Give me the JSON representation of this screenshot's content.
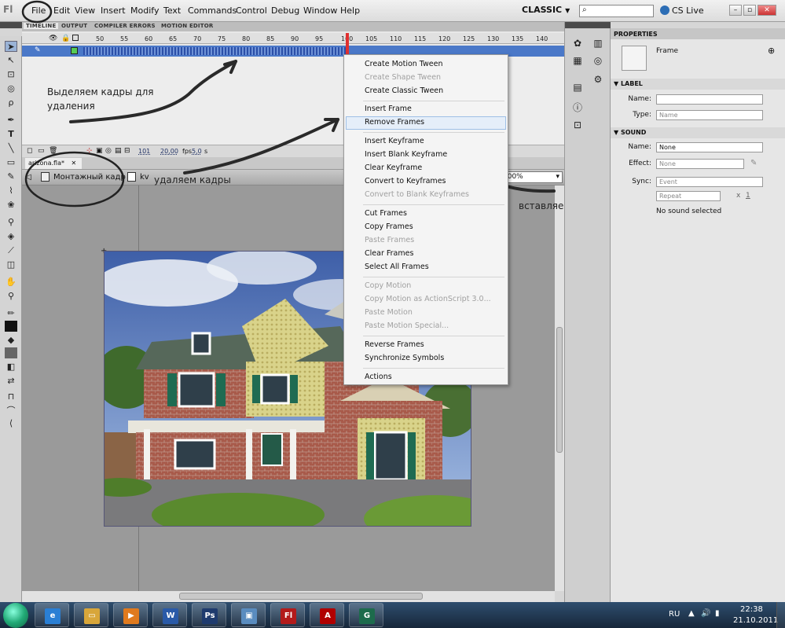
{
  "menubar": {
    "items": [
      "File",
      "Edit",
      "View",
      "Insert",
      "Modify",
      "Text",
      "Commands",
      "Control",
      "Debug",
      "Window",
      "Help"
    ],
    "workspace": "CLASSIC",
    "search_placeholder": "",
    "cslive": "CS Live"
  },
  "timeline": {
    "tabs": [
      "TIMELINE",
      "OUTPUT",
      "COMPILER ERRORS",
      "MOTION EDITOR"
    ],
    "ruler": [
      "50",
      "55",
      "60",
      "65",
      "70",
      "75",
      "80",
      "85",
      "90",
      "95",
      "100",
      "105",
      "110",
      "115",
      "120",
      "125",
      "130",
      "135",
      "140"
    ],
    "status": {
      "frame": "101",
      "fps": "20,00",
      "fps_unit": "fps",
      "time": "5,0",
      "time_unit": "s"
    }
  },
  "document": {
    "tab": "arizona.fla*",
    "scene": "Монтажный кадр 1",
    "symbol": "kv",
    "zoom": "100%"
  },
  "context_menu": {
    "groups": [
      [
        {
          "label": "Create Motion Tween",
          "enabled": true
        },
        {
          "label": "Create Shape Tween",
          "enabled": false
        },
        {
          "label": "Create Classic Tween",
          "enabled": true
        }
      ],
      [
        {
          "label": "Insert Frame",
          "enabled": true
        },
        {
          "label": "Remove Frames",
          "enabled": true
        }
      ],
      [
        {
          "label": "Insert Keyframe",
          "enabled": true
        },
        {
          "label": "Insert Blank Keyframe",
          "enabled": true
        },
        {
          "label": "Clear Keyframe",
          "enabled": true
        },
        {
          "label": "Convert to Keyframes",
          "enabled": true
        },
        {
          "label": "Convert to Blank Keyframes",
          "enabled": false
        }
      ],
      [
        {
          "label": "Cut Frames",
          "enabled": true
        },
        {
          "label": "Copy Frames",
          "enabled": true
        },
        {
          "label": "Paste Frames",
          "enabled": false
        },
        {
          "label": "Clear Frames",
          "enabled": true
        },
        {
          "label": "Select All Frames",
          "enabled": true
        }
      ],
      [
        {
          "label": "Copy Motion",
          "enabled": false
        },
        {
          "label": "Copy Motion as ActionScript 3.0...",
          "enabled": false
        },
        {
          "label": "Paste Motion",
          "enabled": false
        },
        {
          "label": "Paste Motion Special...",
          "enabled": false
        }
      ],
      [
        {
          "label": "Reverse Frames",
          "enabled": true
        },
        {
          "label": "Synchronize Symbols",
          "enabled": true
        }
      ],
      [
        {
          "label": "Actions",
          "enabled": true
        }
      ]
    ],
    "highlighted": "Remove Frames"
  },
  "annotations": {
    "select_frames": "Выделяем кадры для\nудаления",
    "remove_frames": "удаляем кадры",
    "insert_keyframe": "вставляем первый ключевой кадр"
  },
  "properties": {
    "title": "PROPERTIES",
    "type": "Frame",
    "label_section": "LABEL",
    "name_label": "Name:",
    "type_label": "Type:",
    "type_value": "Name",
    "sound_section": "SOUND",
    "sound_name_label": "Name:",
    "sound_name_value": "None",
    "effect_label": "Effect:",
    "effect_value": "None",
    "sync_label": "Sync:",
    "sync_value": "Event",
    "repeat_value": "Repeat",
    "repeat_times": "1",
    "repeat_x": "x",
    "no_sound": "No sound selected"
  },
  "taskbar": {
    "apps": [
      {
        "name": "internet-explorer",
        "glyph": "e",
        "color": "#2a7fd4"
      },
      {
        "name": "explorer",
        "glyph": "▭",
        "color": "#d8a63a"
      },
      {
        "name": "media-player",
        "glyph": "▶",
        "color": "#e07a1e"
      },
      {
        "name": "word",
        "glyph": "W",
        "color": "#2a5aa8"
      },
      {
        "name": "photoshop",
        "glyph": "Ps",
        "color": "#1f3b6e"
      },
      {
        "name": "image-viewer",
        "glyph": "▣",
        "color": "#5a8cbf"
      },
      {
        "name": "flash",
        "glyph": "Fl",
        "color": "#b31b1b"
      },
      {
        "name": "acrobat",
        "glyph": "A",
        "color": "#b00000"
      },
      {
        "name": "app-g",
        "glyph": "G",
        "color": "#1d6b4c"
      }
    ],
    "lang": "RU",
    "time": "22:38",
    "date": "21.10.2011"
  },
  "colors": {
    "accent": "#4a78c8",
    "playhead": "#e03030",
    "menu_hover": "#e5eef9"
  }
}
